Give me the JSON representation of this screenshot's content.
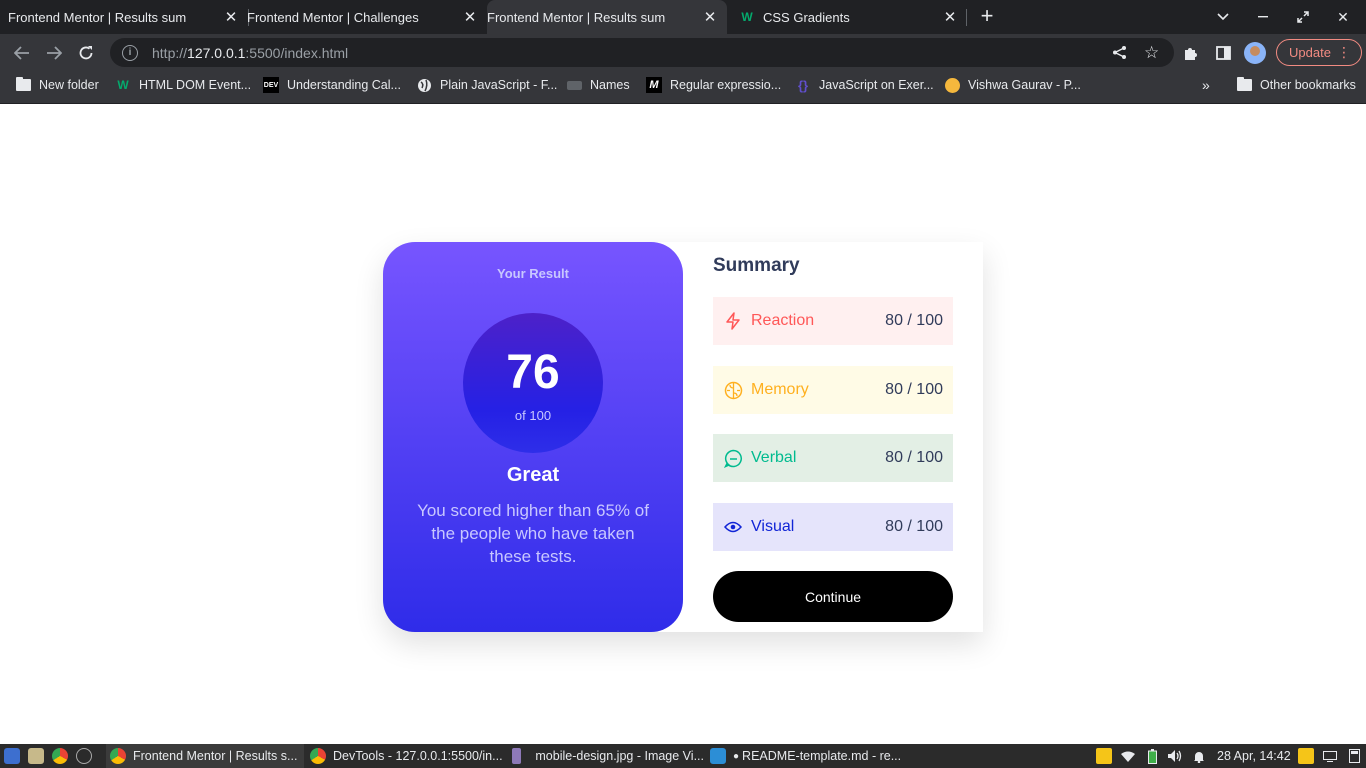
{
  "browser": {
    "tabs": [
      {
        "title": "Frontend Mentor | Results sum",
        "active": false
      },
      {
        "title": "Frontend Mentor | Challenges",
        "active": false
      },
      {
        "title": "Frontend Mentor | Results sum",
        "active": true
      },
      {
        "title": "CSS Gradients",
        "active": false
      }
    ],
    "url_prefix": "http://",
    "url_host": "127.0.0.1",
    "url_rest": ":5500/index.html",
    "update_label": "Update",
    "bookmarks": [
      {
        "label": "New folder",
        "icon": "folder-icon"
      },
      {
        "label": "HTML DOM Event...",
        "icon": "w3schools-icon"
      },
      {
        "label": "Understanding Cal...",
        "icon": "dev-icon"
      },
      {
        "label": "Plain JavaScript - F...",
        "icon": "globe-icon"
      },
      {
        "label": "Names",
        "icon": "keyboard-icon"
      },
      {
        "label": "Regular expressio...",
        "icon": "m-icon"
      },
      {
        "label": "JavaScript on Exer...",
        "icon": "exercism-icon"
      },
      {
        "label": "Vishwa Gaurav - P...",
        "icon": "avatar-icon"
      }
    ],
    "other_bookmarks": "Other bookmarks"
  },
  "result": {
    "heading": "Your Result",
    "score": "76",
    "of_label": "of 100",
    "grade": "Great",
    "description": "You scored higher than 65% of the people who have taken these tests."
  },
  "summary": {
    "title": "Summary",
    "items": [
      {
        "label": "Reaction",
        "score": "80",
        "max": " / 100",
        "color": "#ff5757",
        "bg": "#fff0f0",
        "icon": "lightning-icon"
      },
      {
        "label": "Memory",
        "score": "80",
        "max": " / 100",
        "color": "#ffb01f",
        "bg": "#fffbe6",
        "icon": "brain-icon"
      },
      {
        "label": "Verbal",
        "score": "80",
        "max": " / 100",
        "color": "#00bb8f",
        "bg": "#e8f4ec",
        "icon": "chat-icon"
      },
      {
        "label": "Visual",
        "score": "80",
        "max": " / 100",
        "color": "#1125d6",
        "bg": "#ececfc",
        "icon": "eye-icon"
      }
    ],
    "continue_label": "Continue"
  },
  "taskbar": {
    "tasks": [
      {
        "label": "Frontend Mentor | Results s...",
        "icon": "chrome-icon",
        "active": true
      },
      {
        "label": "DevTools - 127.0.0.1:5500/in...",
        "icon": "chrome-icon",
        "active": false
      },
      {
        "label": "mobile-design.jpg - Image Vi...",
        "icon": "image-viewer-icon",
        "active": false
      },
      {
        "label": "README-template.md - re...",
        "icon": "vscode-icon",
        "active": false
      }
    ],
    "clock": "28 Apr, 14:42"
  }
}
